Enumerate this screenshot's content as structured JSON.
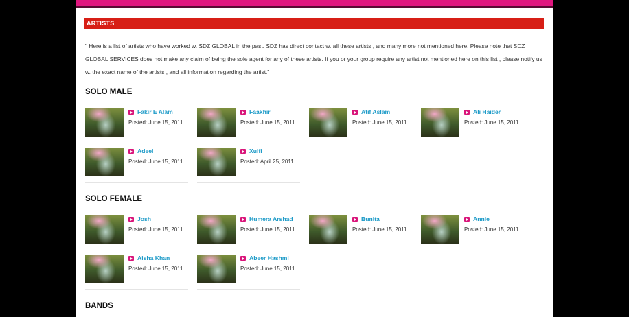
{
  "section": {
    "title": "ARTISTS"
  },
  "intro": "\" Here is a list of artists who have worked w. SDZ GLOBAL in the past. SDZ has direct contact w. all these artists , and many more not mentioned here. Please note that SDZ GLOBAL SERVICES does not make any claim of being the sole agent for any of these artists. If you or your group require any artist not mentioned here on this list , please notify us w. the exact name of the artists , and all information regarding the artist.\"",
  "categories": [
    {
      "title": "SOLO MALE",
      "artists": [
        {
          "name": "Fakir E Alam",
          "posted": "Posted: June 15, 2011"
        },
        {
          "name": "Faakhir",
          "posted": "Posted: June 15, 2011"
        },
        {
          "name": "Atif Aslam",
          "posted": "Posted: June 15, 2011"
        },
        {
          "name": "Ali Haider",
          "posted": "Posted: June 15, 2011"
        },
        {
          "name": "Adeel",
          "posted": "Posted: June 15, 2011"
        },
        {
          "name": "Xulfi",
          "posted": "Posted: April 25, 2011"
        }
      ]
    },
    {
      "title": "SOLO FEMALE",
      "artists": [
        {
          "name": "Josh",
          "posted": "Posted: June 15, 2011"
        },
        {
          "name": "Humera Arshad",
          "posted": "Posted: June 15, 2011"
        },
        {
          "name": "Bunita",
          "posted": "Posted: June 15, 2011"
        },
        {
          "name": "Annie",
          "posted": "Posted: June 15, 2011"
        },
        {
          "name": "Aisha Khan",
          "posted": "Posted: June 15, 2011"
        },
        {
          "name": "Abeer Hashmi",
          "posted": "Posted: June 15, 2011"
        }
      ]
    },
    {
      "title": "BANDS",
      "artists": []
    }
  ],
  "colors": {
    "topbar": "#e0167f",
    "section_bar": "#d71f16",
    "link": "#1e9bc8",
    "arrow": "#d9157a"
  },
  "icons": {
    "bullet": "play-arrow-icon",
    "thumbnail": "artist-thumbnail"
  }
}
